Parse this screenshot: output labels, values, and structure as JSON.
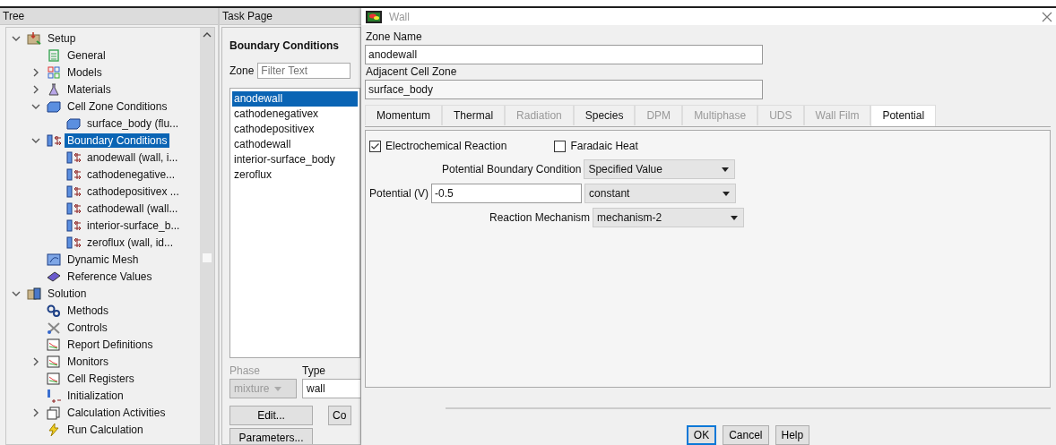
{
  "tree": {
    "title": "Tree",
    "items": [
      {
        "label": "Setup",
        "kind": "setup",
        "expanded": true,
        "selected": false,
        "children": [
          {
            "label": "General",
            "kind": "list",
            "selected": false
          },
          {
            "label": "Models",
            "kind": "models",
            "expanded": false,
            "selected": false
          },
          {
            "label": "Materials",
            "kind": "flask",
            "expanded": false,
            "selected": false
          },
          {
            "label": "Cell Zone Conditions",
            "kind": "cellzone",
            "expanded": true,
            "selected": false,
            "children": [
              {
                "label": "surface_body (flu...",
                "kind": "cellzone",
                "selected": false
              }
            ]
          },
          {
            "label": "Boundary Conditions",
            "kind": "boundary",
            "expanded": true,
            "selected": true,
            "children": [
              {
                "label": "anodewall (wall, i...",
                "kind": "boundary",
                "selected": false
              },
              {
                "label": "cathodenegative...",
                "kind": "boundary",
                "selected": false
              },
              {
                "label": "cathodepositivex ...",
                "kind": "boundary",
                "selected": false
              },
              {
                "label": "cathodewall (wall...",
                "kind": "boundary",
                "selected": false
              },
              {
                "label": "interior-surface_b...",
                "kind": "boundary",
                "selected": false
              },
              {
                "label": "zeroflux (wall, id...",
                "kind": "boundary",
                "selected": false
              }
            ]
          },
          {
            "label": "Dynamic Mesh",
            "kind": "mesh",
            "selected": false
          },
          {
            "label": "Reference Values",
            "kind": "book",
            "selected": false
          }
        ]
      },
      {
        "label": "Solution",
        "kind": "solution",
        "expanded": true,
        "selected": false,
        "children": [
          {
            "label": "Methods",
            "kind": "gears",
            "selected": false
          },
          {
            "label": "Controls",
            "kind": "tools",
            "selected": false
          },
          {
            "label": "Report Definitions",
            "kind": "chart",
            "selected": false
          },
          {
            "label": "Monitors",
            "kind": "chart",
            "expanded": false,
            "selected": false
          },
          {
            "label": "Cell Registers",
            "kind": "chart",
            "selected": false
          },
          {
            "label": "Initialization",
            "kind": "init",
            "selected": false
          },
          {
            "label": "Calculation Activities",
            "kind": "activities",
            "expanded": false,
            "selected": false
          },
          {
            "label": "Run Calculation",
            "kind": "bolt",
            "selected": false
          }
        ]
      }
    ]
  },
  "task_page": {
    "title": "Task Page",
    "heading": "Boundary Conditions",
    "zone_label": "Zone",
    "filter": {
      "placeholder": "Filter Text"
    },
    "zones": [
      {
        "label": "anodewall",
        "selected": true
      },
      {
        "label": "cathodenegativex",
        "selected": false
      },
      {
        "label": "cathodepositivex",
        "selected": false
      },
      {
        "label": "cathodewall",
        "selected": false
      },
      {
        "label": "interior-surface_body",
        "selected": false
      },
      {
        "label": "zeroflux",
        "selected": false
      }
    ],
    "phase_label": "Phase",
    "phase": {
      "value": "mixture",
      "disabled": true
    },
    "type_label": "Type",
    "type": {
      "value": "wall"
    },
    "buttons": [
      "Edit...",
      "Co",
      "Parameters..."
    ]
  },
  "dialog": {
    "title": "Wall",
    "zone_name_label": "Zone Name",
    "zone_name": "anodewall",
    "adjacent_label": "Adjacent Cell Zone",
    "adjacent": "surface_body",
    "tabs": [
      {
        "label": "Momentum",
        "disabled": false,
        "selected": false
      },
      {
        "label": "Thermal",
        "disabled": false,
        "selected": false
      },
      {
        "label": "Radiation",
        "disabled": true,
        "selected": false
      },
      {
        "label": "Species",
        "disabled": false,
        "selected": false
      },
      {
        "label": "DPM",
        "disabled": true,
        "selected": false
      },
      {
        "label": "Multiphase",
        "disabled": true,
        "selected": false
      },
      {
        "label": "UDS",
        "disabled": true,
        "selected": false
      },
      {
        "label": "Wall Film",
        "disabled": true,
        "selected": false
      },
      {
        "label": "Potential",
        "disabled": false,
        "selected": true
      }
    ],
    "checkboxes": [
      {
        "label": "Electrochemical Reaction",
        "checked": true
      },
      {
        "label": "Faradaic Heat",
        "checked": false
      }
    ],
    "potential_bc": {
      "label": "Potential Boundary Condition",
      "value": "Specified Value"
    },
    "potential": {
      "label": "Potential (V)",
      "value": "-0.5",
      "method": "constant"
    },
    "mechanism": {
      "label": "Reaction Mechanism",
      "value": "mechanism-2"
    },
    "buttons": [
      {
        "label": "OK",
        "default": true
      },
      {
        "label": "Cancel",
        "default": false
      },
      {
        "label": "Help",
        "default": false
      }
    ]
  }
}
